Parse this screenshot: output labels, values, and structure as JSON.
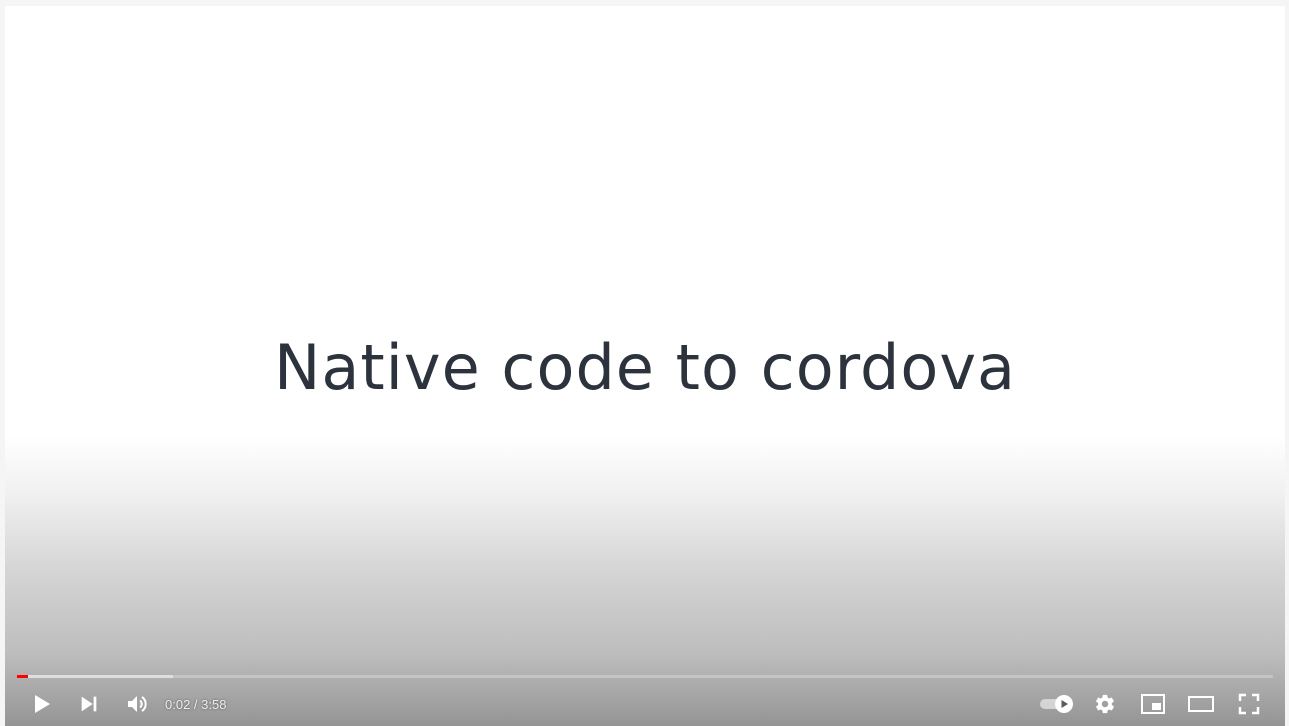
{
  "video": {
    "slide_title": "Native code to cordova",
    "current_time": "0:02",
    "time_separator": " / ",
    "duration": "3:58",
    "played_fraction": 0.0085,
    "buffered_fraction": 0.124
  },
  "controls": {
    "play_icon": "play-icon",
    "next_icon": "next-icon",
    "volume_icon": "volume-icon",
    "autoplay_icon": "autoplay-toggle-icon",
    "autoplay_on": true,
    "settings_icon": "gear-icon",
    "miniplayer_icon": "miniplayer-icon",
    "theater_icon": "theater-mode-icon",
    "fullscreen_icon": "fullscreen-icon"
  },
  "colors": {
    "progress_played": "#ff0000",
    "title_text": "#2c333d"
  }
}
